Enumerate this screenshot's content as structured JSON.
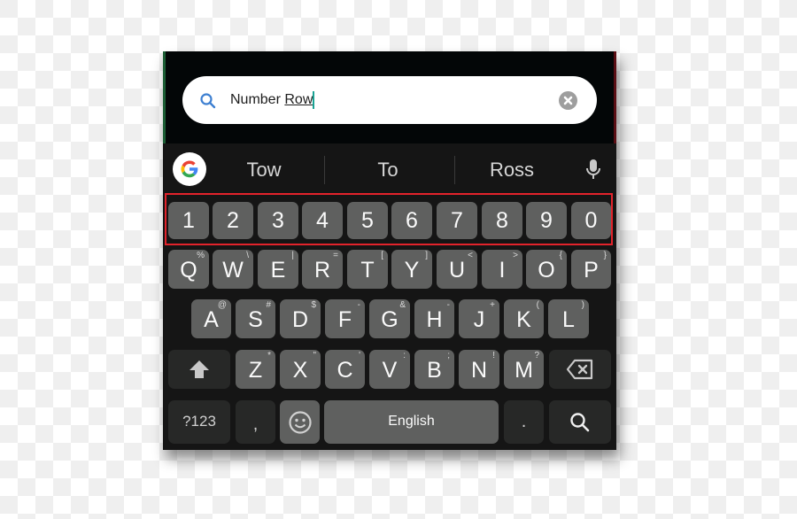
{
  "search": {
    "value_plain": "Number ",
    "value_composing": "Row",
    "icon": "search-icon",
    "clear_icon": "clear-icon"
  },
  "suggestions": {
    "items": [
      "Tow",
      "To",
      "Ross"
    ],
    "left_icon": "google-g-icon",
    "right_icon": "microphone-icon"
  },
  "highlight": {
    "label": "Number Row",
    "color": "#e2232b"
  },
  "keyboard": {
    "number_row": [
      "1",
      "2",
      "3",
      "4",
      "5",
      "6",
      "7",
      "8",
      "9",
      "0"
    ],
    "row1": [
      {
        "key": "Q",
        "hint": "%"
      },
      {
        "key": "W",
        "hint": "\\"
      },
      {
        "key": "E",
        "hint": "|"
      },
      {
        "key": "R",
        "hint": "="
      },
      {
        "key": "T",
        "hint": "["
      },
      {
        "key": "Y",
        "hint": "]"
      },
      {
        "key": "U",
        "hint": "<"
      },
      {
        "key": "I",
        "hint": ">"
      },
      {
        "key": "O",
        "hint": "{"
      },
      {
        "key": "P",
        "hint": "}"
      }
    ],
    "row2": [
      {
        "key": "A",
        "hint": "@"
      },
      {
        "key": "S",
        "hint": "#"
      },
      {
        "key": "D",
        "hint": "$"
      },
      {
        "key": "F",
        "hint": "-"
      },
      {
        "key": "G",
        "hint": "&"
      },
      {
        "key": "H",
        "hint": "-"
      },
      {
        "key": "J",
        "hint": "+"
      },
      {
        "key": "K",
        "hint": "("
      },
      {
        "key": "L",
        "hint": ")"
      }
    ],
    "row3": [
      {
        "key": "Z",
        "hint": "*"
      },
      {
        "key": "X",
        "hint": "\""
      },
      {
        "key": "C",
        "hint": "'"
      },
      {
        "key": "V",
        "hint": ":"
      },
      {
        "key": "B",
        "hint": ";"
      },
      {
        "key": "N",
        "hint": "!"
      },
      {
        "key": "M",
        "hint": "?"
      }
    ],
    "shift_icon": "shift-icon",
    "backspace_icon": "backspace-icon",
    "symbols_label": "?123",
    "comma_label": ",",
    "emoji_icon": "emoji-icon",
    "space_label": "English",
    "period_label": ".",
    "action_icon": "search-icon"
  },
  "colors": {
    "key": "#5f605f",
    "key_dark": "#272827",
    "keyboard_bg": "#151515",
    "caret": "#1aa394",
    "search_icon": "#3d7fd1"
  }
}
